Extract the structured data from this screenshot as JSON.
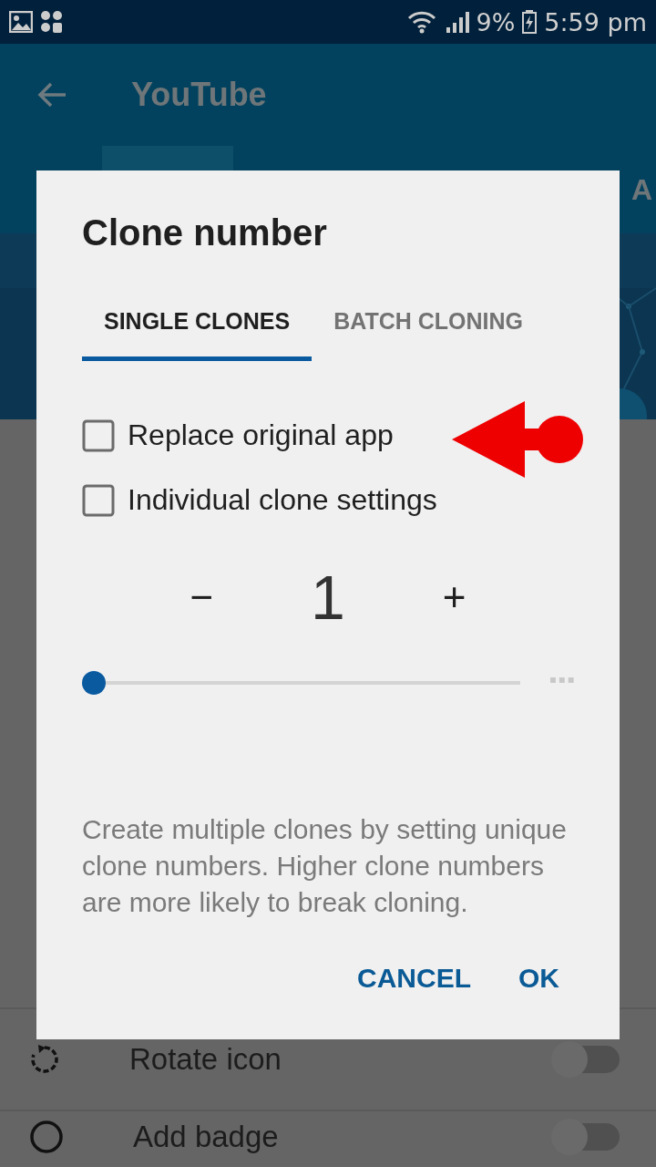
{
  "status_bar": {
    "battery": "9%",
    "time": "5:59 pm"
  },
  "app_bar": {
    "title": "YouTube",
    "tab_fragment": "A"
  },
  "settings": [
    {
      "label": "Rotate icon",
      "on": false,
      "kind": "rotate"
    },
    {
      "label": "Add badge",
      "on": false,
      "kind": "badge"
    }
  ],
  "dialog": {
    "title": "Clone number",
    "tabs": [
      {
        "label": "SINGLE CLONES",
        "selected": true
      },
      {
        "label": "BATCH CLONING",
        "selected": false
      }
    ],
    "options": [
      {
        "label": "Replace original app",
        "checked": false
      },
      {
        "label": "Individual clone settings",
        "checked": false
      }
    ],
    "counter": {
      "minus": "−",
      "value": "1",
      "plus": "+"
    },
    "slider": {
      "level": 0
    },
    "description": "Create multiple clones by setting unique clone numbers. Higher clone numbers are more likely to break cloning.",
    "buttons": [
      "CANCEL",
      "OK"
    ]
  }
}
